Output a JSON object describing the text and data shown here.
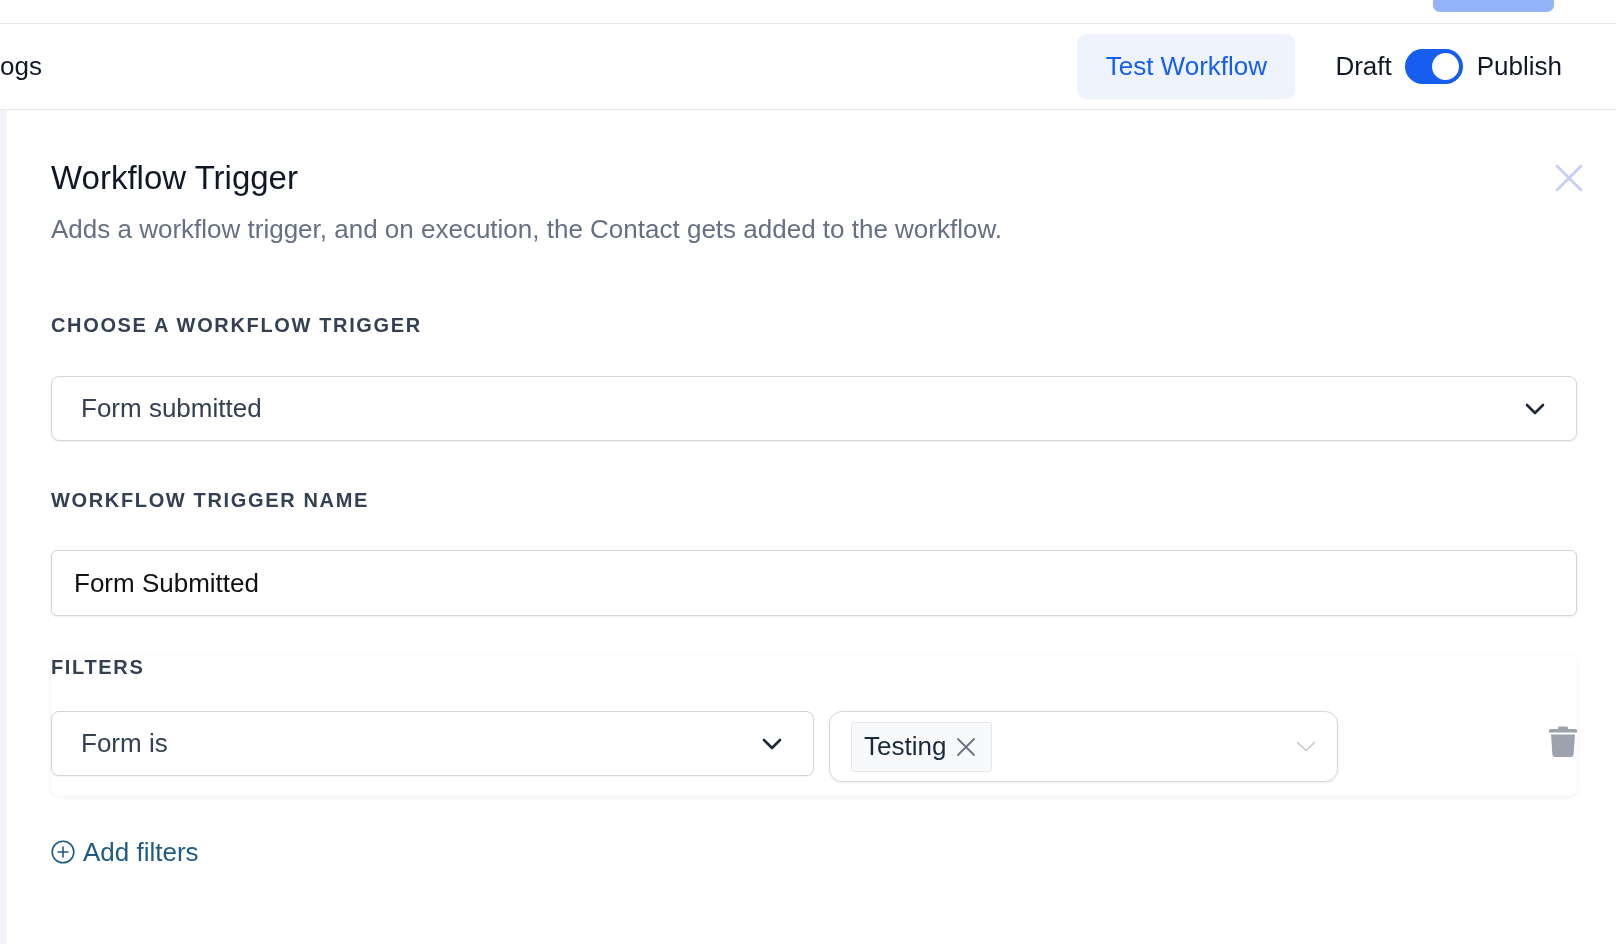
{
  "header": {
    "tabs": [
      {
        "label": "ogs"
      }
    ],
    "test_button": "Test Workflow",
    "publish_toggle": {
      "off_label": "Draft",
      "on_label": "Publish",
      "on": true
    }
  },
  "panel": {
    "title": "Workflow Trigger",
    "description": "Adds a workflow trigger, and on execution, the Contact gets added to the workflow."
  },
  "trigger": {
    "label": "CHOOSE A WORKFLOW TRIGGER",
    "value": "Form submitted"
  },
  "trigger_name": {
    "label": "WORKFLOW TRIGGER NAME",
    "value": "Form Submitted"
  },
  "filters": {
    "label": "FILTERS",
    "rows": [
      {
        "field": "Form is",
        "values": [
          "Testing"
        ]
      }
    ],
    "add_button": "Add filters"
  }
}
